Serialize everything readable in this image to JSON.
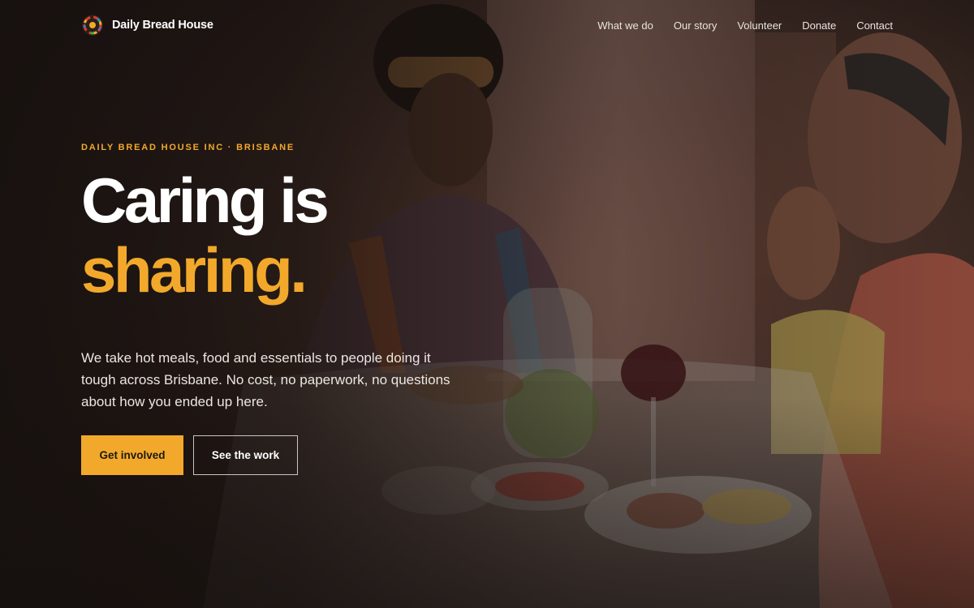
{
  "brand": {
    "name": "Daily Bread House"
  },
  "nav": {
    "items": [
      {
        "label": "What we do"
      },
      {
        "label": "Our story"
      },
      {
        "label": "Volunteer"
      },
      {
        "label": "Donate"
      },
      {
        "label": "Contact"
      }
    ]
  },
  "hero": {
    "eyebrow": "DAILY BREAD HOUSE INC · BRISBANE",
    "headline_line1": "Caring is",
    "headline_line2": "sharing.",
    "lede": "We take hot meals, food and essentials to people doing it tough across Brisbane. No cost, no paperwork, no questions about how you ended up here.",
    "primary_cta": "Get involved",
    "secondary_cta": "See the work"
  },
  "colors": {
    "accent": "#f2a92b",
    "background": "#1a1412",
    "text": "#ffffff"
  },
  "icons": {
    "logo": "colorful-circle-logo"
  }
}
